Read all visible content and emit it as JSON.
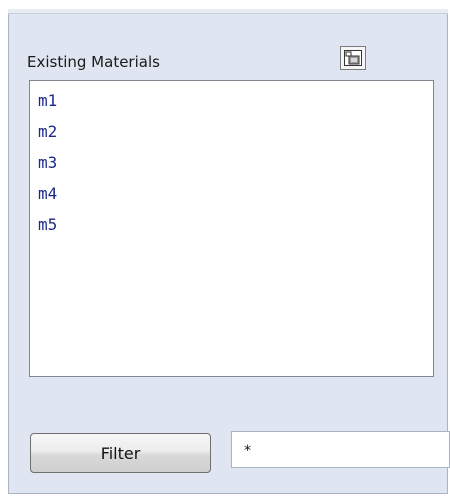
{
  "materials_panel": {
    "label": "Existing Materials",
    "action_icon": "window-icon",
    "items": [
      {
        "label": "m1"
      },
      {
        "label": "m2"
      },
      {
        "label": "m3"
      },
      {
        "label": "m4"
      },
      {
        "label": "m5"
      }
    ]
  },
  "filter": {
    "button_label": "Filter",
    "input_value": "*"
  },
  "colors": {
    "panel_bg": "#dfe6f1",
    "item_text": "#1b2a8a"
  }
}
